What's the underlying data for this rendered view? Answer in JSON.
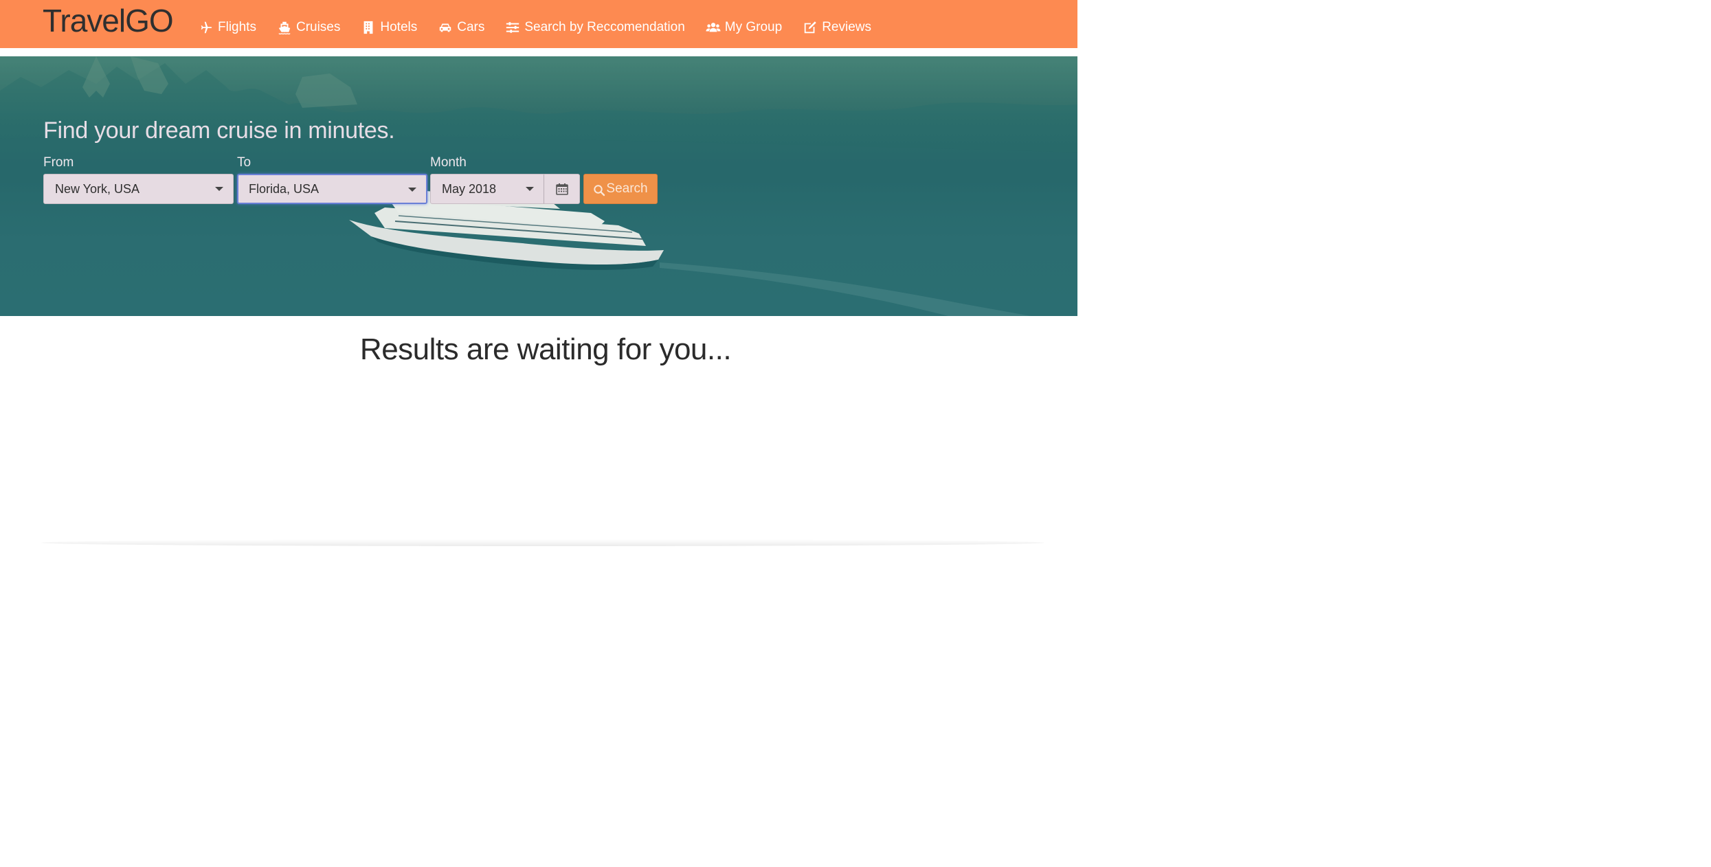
{
  "brand": "TravelGO",
  "nav": [
    {
      "label": "Flights",
      "icon": "plane-icon"
    },
    {
      "label": "Cruises",
      "icon": "ship-icon"
    },
    {
      "label": "Hotels",
      "icon": "building-icon"
    },
    {
      "label": "Cars",
      "icon": "car-icon"
    },
    {
      "label": "Search by Reccomendation",
      "icon": "sliders-icon"
    },
    {
      "label": "My Group",
      "icon": "users-icon"
    },
    {
      "label": "Reviews",
      "icon": "edit-icon"
    }
  ],
  "hero": {
    "headline": "Find your dream cruise in minutes.",
    "from": {
      "label": "From",
      "value": "New York, USA"
    },
    "to": {
      "label": "To",
      "value": "Florida, USA"
    },
    "month": {
      "label": "Month",
      "value": "May 2018"
    },
    "search_label": "Search"
  },
  "results": {
    "title": "Results are waiting for you..."
  },
  "colors": {
    "navbar": "#fd8a51",
    "search_button": "#ef9148",
    "hero_overlay": "#2b6d6b"
  }
}
